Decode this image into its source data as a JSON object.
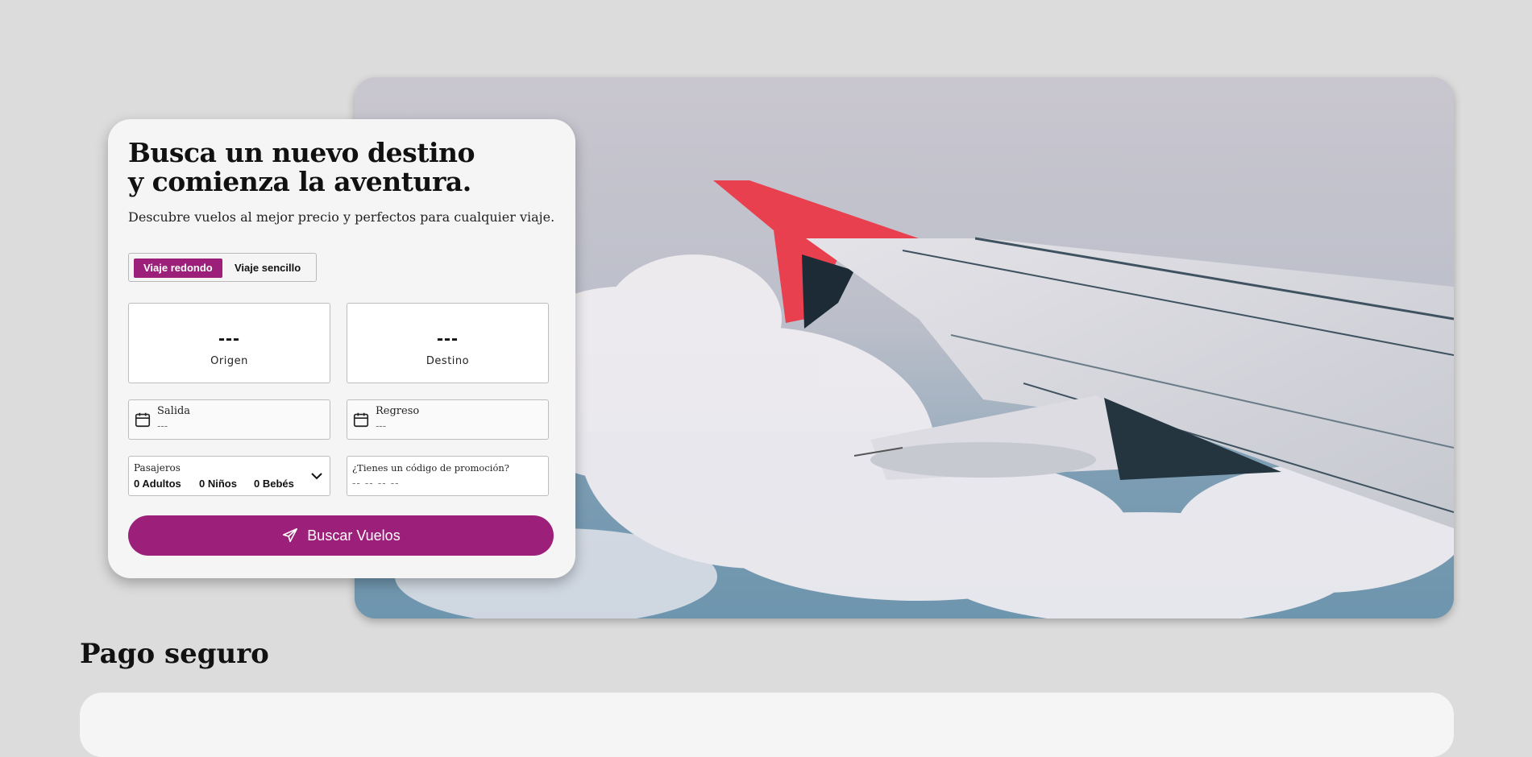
{
  "search": {
    "title_line1": "Busca un nuevo destino",
    "title_line2": "y comienza la aventura.",
    "subtitle": "Descubre vuelos al mejor precio y perfectos para cualquier viaje.",
    "trip_types": {
      "round": "Viaje redondo",
      "oneway": "Viaje sencillo",
      "selected": "round"
    },
    "origin": {
      "code": "---",
      "label": "Origen"
    },
    "destination": {
      "code": "---",
      "label": "Destino"
    },
    "departure": {
      "label": "Salida",
      "value": "---"
    },
    "return": {
      "label": "Regreso",
      "value": "---"
    },
    "passengers": {
      "label": "Pasajeros",
      "adults": "0 Adultos",
      "children": "0 Niños",
      "infants": "0 Bebés"
    },
    "promo": {
      "label": "¿Tienes un código de promoción?",
      "value": "-- -- -- --"
    },
    "button_label": "Buscar Vuelos"
  },
  "secure_payment": {
    "title": "Pago seguro"
  },
  "colors": {
    "accent": "#9c2079",
    "background": "#dcdcdc",
    "card": "#f5f5f5"
  },
  "icons": [
    "calendar-icon",
    "chevron-down-icon",
    "plane-icon"
  ]
}
